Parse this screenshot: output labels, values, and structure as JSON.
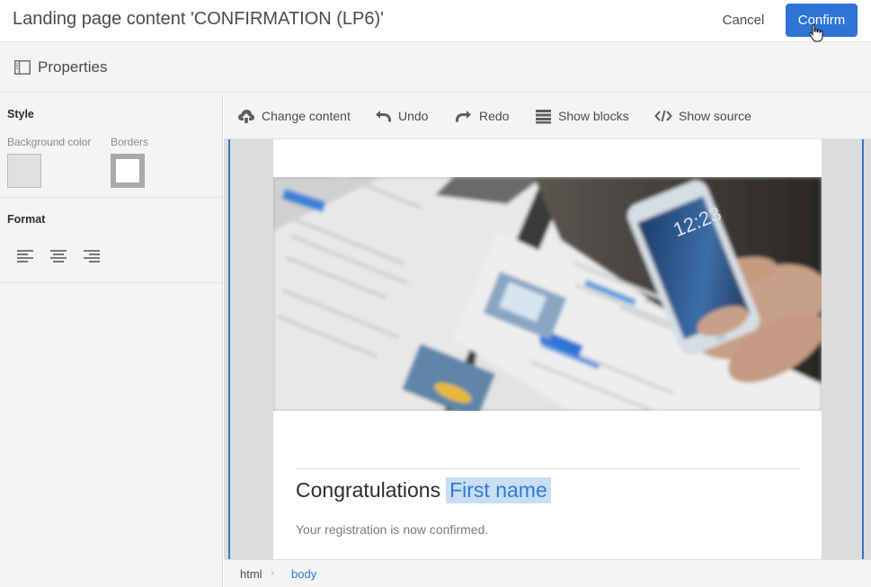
{
  "header": {
    "title": "Landing page content 'CONFIRMATION (LP6)'",
    "cancel_label": "Cancel",
    "confirm_label": "Confirm"
  },
  "properties": {
    "label": "Properties",
    "icon": "properties-panel-icon"
  },
  "style_section": {
    "title": "Style",
    "background_color_label": "Background color",
    "borders_label": "Borders",
    "background_color_value": "#e0e0e0",
    "border_color_value": "#a9a9a9"
  },
  "format_section": {
    "title": "Format",
    "alignments": [
      "align-left-icon",
      "align-center-icon",
      "align-right-icon"
    ]
  },
  "toolbar": {
    "change_content": "Change content",
    "undo": "Undo",
    "redo": "Redo",
    "show_blocks": "Show blocks",
    "show_source": "Show source"
  },
  "content": {
    "heading": "Congratulations",
    "personalization_field": "First name",
    "message": "Your registration is now confirmed."
  },
  "breadcrumb": {
    "items": [
      "html",
      "body"
    ]
  },
  "colors": {
    "accent": "#2e73d6",
    "selection": "#3b73c9",
    "personalization_bg": "#c9ddf3"
  }
}
